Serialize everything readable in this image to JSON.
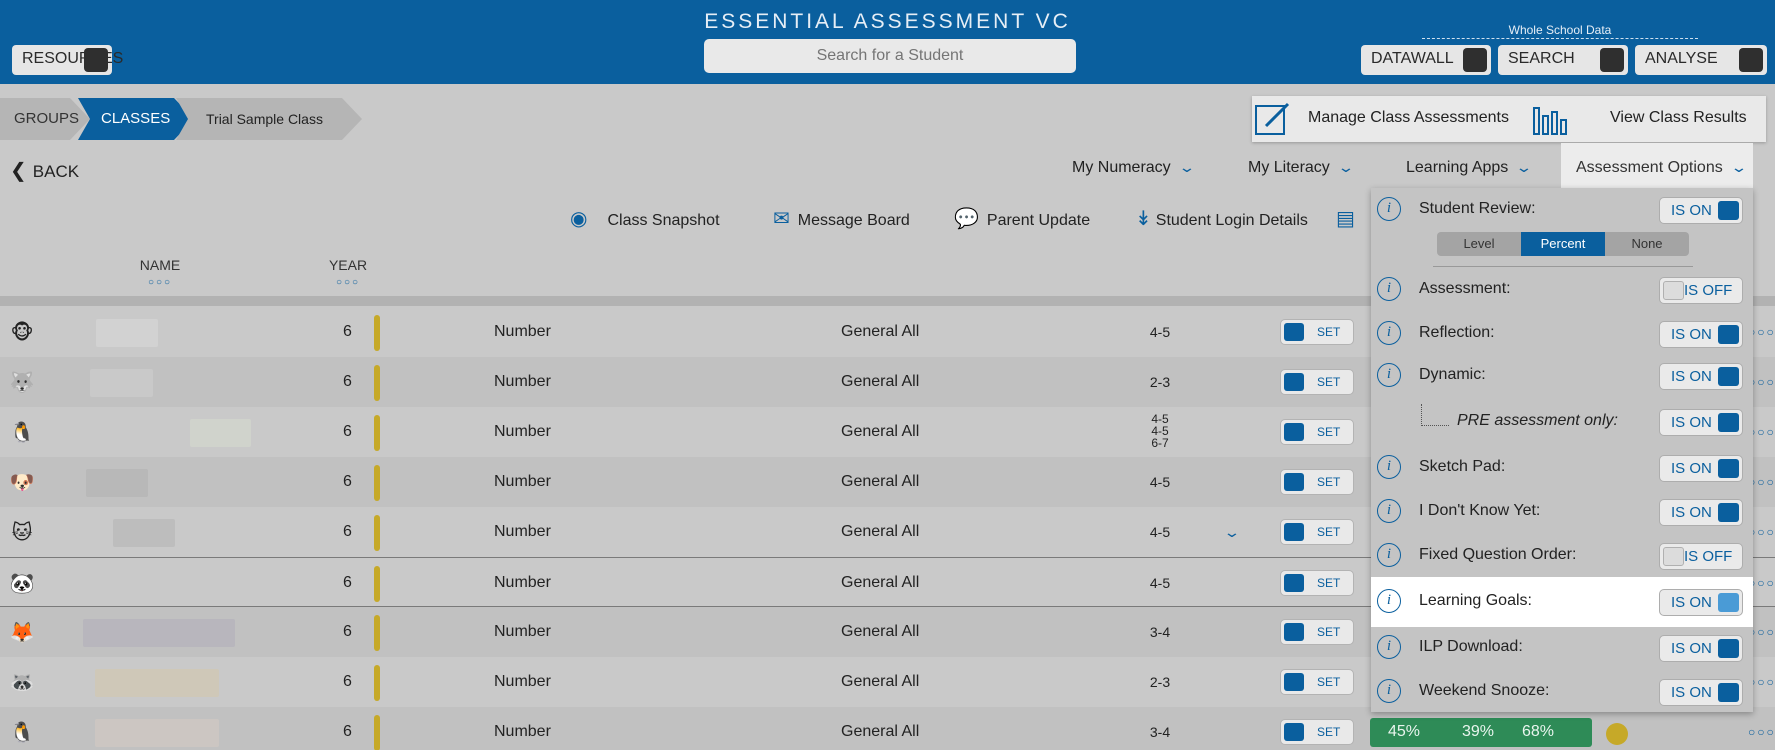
{
  "header": {
    "title": "ESSENTIAL ASSESSMENT VC",
    "search_placeholder": "Search for a Student",
    "resources_label": "RESOURCES",
    "whole_school_label": "Whole School Data",
    "datawall_label": "DATAWALL",
    "search_label": "SEARCH",
    "analyse_label": "ANALYSE"
  },
  "breadcrumb": {
    "groups": "GROUPS",
    "classes": "CLASSES",
    "current": "Trial Sample Class"
  },
  "class_actions": {
    "manage": "Manage Class Assessments",
    "view_results": "View Class Results"
  },
  "nav": {
    "back": "BACK",
    "my_numeracy": "My Numeracy",
    "my_literacy": "My Literacy",
    "learning_apps": "Learning Apps",
    "assessment_options": "Assessment Options"
  },
  "toolbar": {
    "class_snapshot": "Class Snapshot",
    "message_board": "Message Board",
    "parent_update": "Parent Update",
    "student_login_details": "Student Login Details"
  },
  "columns": {
    "name": "NAME",
    "year": "YEAR"
  },
  "rows": [
    {
      "avatar": "🐵",
      "year": "6",
      "strand": "Number",
      "topic": "General All",
      "range": "4-5",
      "set": "SET"
    },
    {
      "avatar": "🐺",
      "year": "6",
      "strand": "Number",
      "topic": "General All",
      "range": "2-3",
      "set": "SET"
    },
    {
      "avatar": "🐧",
      "year": "6",
      "strand": "Number",
      "topic": "General All",
      "range_lines": [
        "4-5",
        "4-5",
        "6-7"
      ],
      "set": "SET"
    },
    {
      "avatar": "🐶",
      "year": "6",
      "strand": "Number",
      "topic": "General All",
      "range": "4-5",
      "set": "SET"
    },
    {
      "avatar": "🐱",
      "year": "6",
      "strand": "Number",
      "topic": "General All",
      "range": "4-5",
      "set": "SET"
    },
    {
      "avatar": "🐼",
      "year": "6",
      "strand": "Number",
      "topic": "General All",
      "range": "4-5",
      "set": "SET"
    },
    {
      "avatar": "🦊",
      "year": "6",
      "strand": "Number",
      "topic": "General All",
      "range": "3-4",
      "set": "SET"
    },
    {
      "avatar": "🦝",
      "year": "6",
      "strand": "Number",
      "topic": "General All",
      "range": "2-3",
      "set": "SET"
    },
    {
      "avatar": "🐧",
      "year": "6",
      "strand": "Number",
      "topic": "General All",
      "range": "3-4",
      "set": "SET",
      "results": [
        "45%",
        "39%",
        "68%"
      ]
    }
  ],
  "assessment_options": {
    "student_review": {
      "label": "Student Review:",
      "state": "IS ON"
    },
    "review_mode": {
      "level": "Level",
      "percent": "Percent",
      "none": "None",
      "selected": "Percent"
    },
    "assessment": {
      "label": "Assessment:",
      "state": "IS OFF"
    },
    "reflection": {
      "label": "Reflection:",
      "state": "IS ON"
    },
    "dynamic": {
      "label": "Dynamic:",
      "state": "IS ON"
    },
    "pre_assessment_only": {
      "label": "PRE assessment only:",
      "state": "IS ON"
    },
    "sketch_pad": {
      "label": "Sketch Pad:",
      "state": "IS ON"
    },
    "i_dont_know_yet": {
      "label": "I Don't Know Yet:",
      "state": "IS ON"
    },
    "fixed_question_order": {
      "label": "Fixed Question Order:",
      "state": "IS OFF"
    },
    "learning_goals": {
      "label": "Learning Goals:",
      "state": "IS ON"
    },
    "ilp_download": {
      "label": "ILP Download:",
      "state": "IS ON"
    },
    "weekend_snooze": {
      "label": "Weekend Snooze:",
      "state": "IS ON"
    }
  },
  "icons": {
    "info": "i",
    "chevron": "v",
    "more_dots": "ooo"
  }
}
